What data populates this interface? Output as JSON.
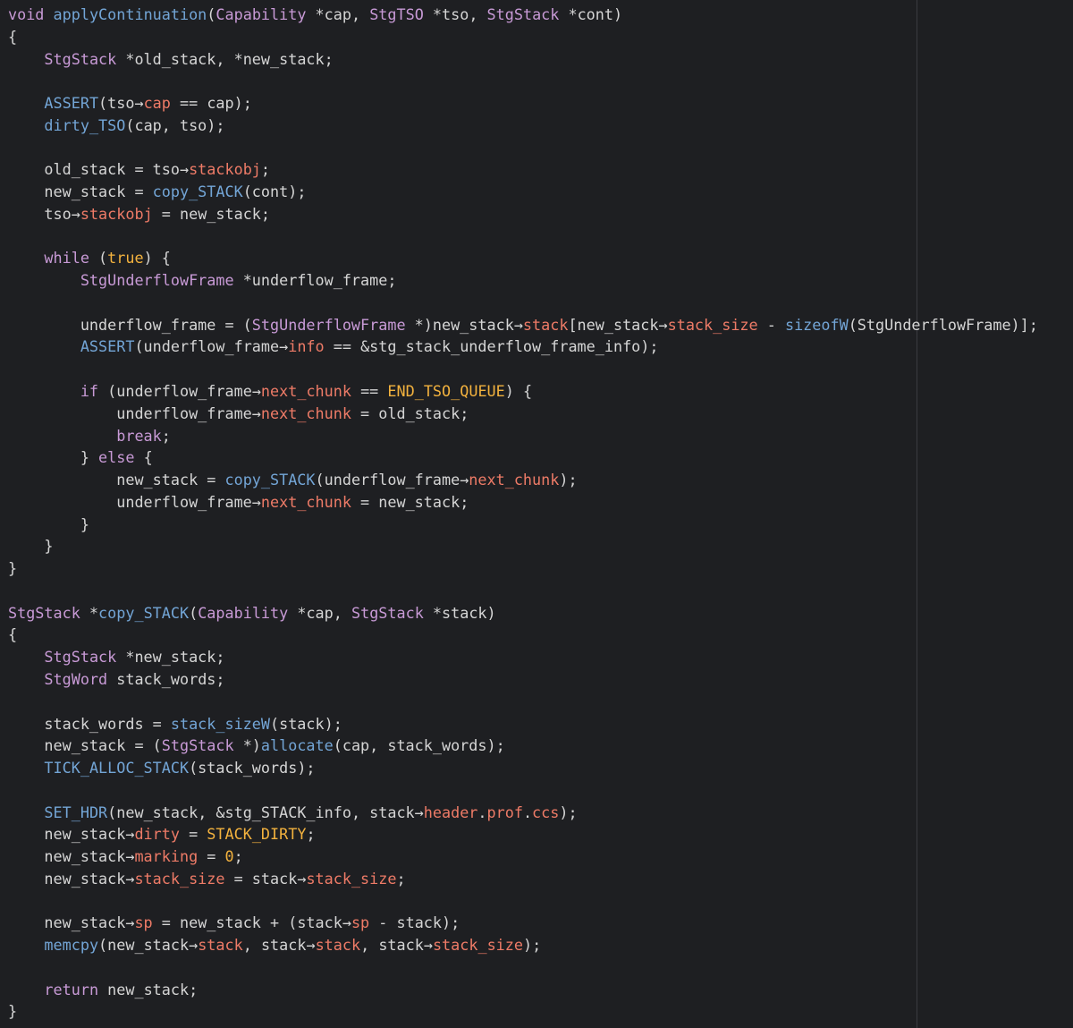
{
  "colors": {
    "background": "#1e1f22",
    "ruler": "#3a3b40",
    "keyword": "#c89ad6",
    "type": "#c89ad6",
    "function": "#73a5d6",
    "field": "#ee7b67",
    "constant": "#f3b23e",
    "number": "#f3b23e",
    "plain": "#d5d5d5"
  },
  "code_lines": [
    [
      [
        "kw",
        "void"
      ],
      [
        "pl",
        " "
      ],
      [
        "fn",
        "applyContinuation"
      ],
      [
        "pl",
        "("
      ],
      [
        "ty",
        "Capability"
      ],
      [
        "pl",
        " *cap, "
      ],
      [
        "ty",
        "StgTSO"
      ],
      [
        "pl",
        " *tso, "
      ],
      [
        "ty",
        "StgStack"
      ],
      [
        "pl",
        " *cont)"
      ]
    ],
    [
      [
        "pl",
        "{"
      ]
    ],
    [
      [
        "pl",
        "    "
      ],
      [
        "ty",
        "StgStack"
      ],
      [
        "pl",
        " *old_stack, *new_stack;"
      ]
    ],
    [],
    [
      [
        "pl",
        "    "
      ],
      [
        "fn",
        "ASSERT"
      ],
      [
        "pl",
        "(tso"
      ],
      [
        "op",
        "→"
      ],
      [
        "fld",
        "cap"
      ],
      [
        "pl",
        " "
      ],
      [
        "op",
        "=="
      ],
      [
        "pl",
        " cap);"
      ]
    ],
    [
      [
        "pl",
        "    "
      ],
      [
        "fn",
        "dirty_TSO"
      ],
      [
        "pl",
        "(cap, tso);"
      ]
    ],
    [],
    [
      [
        "pl",
        "    old_stack = tso"
      ],
      [
        "op",
        "→"
      ],
      [
        "fld",
        "stackobj"
      ],
      [
        "pl",
        ";"
      ]
    ],
    [
      [
        "pl",
        "    new_stack = "
      ],
      [
        "fn",
        "copy_STACK"
      ],
      [
        "pl",
        "(cont);"
      ]
    ],
    [
      [
        "pl",
        "    tso"
      ],
      [
        "op",
        "→"
      ],
      [
        "fld",
        "stackobj"
      ],
      [
        "pl",
        " = new_stack;"
      ]
    ],
    [],
    [
      [
        "pl",
        "    "
      ],
      [
        "kw",
        "while"
      ],
      [
        "pl",
        " ("
      ],
      [
        "cst",
        "true"
      ],
      [
        "pl",
        ") {"
      ]
    ],
    [
      [
        "pl",
        "        "
      ],
      [
        "ty",
        "StgUnderflowFrame"
      ],
      [
        "pl",
        " *underflow_frame;"
      ]
    ],
    [],
    [
      [
        "pl",
        "        underflow_frame = ("
      ],
      [
        "ty",
        "StgUnderflowFrame"
      ],
      [
        "pl",
        " *)new_stack"
      ],
      [
        "op",
        "→"
      ],
      [
        "fld",
        "stack"
      ],
      [
        "pl",
        "[new_stack"
      ],
      [
        "op",
        "→"
      ],
      [
        "fld",
        "stack_size"
      ],
      [
        "pl",
        " - "
      ],
      [
        "fn",
        "sizeofW"
      ],
      [
        "pl",
        "(StgUnderflowFrame)];"
      ]
    ],
    [
      [
        "pl",
        "        "
      ],
      [
        "fn",
        "ASSERT"
      ],
      [
        "pl",
        "(underflow_frame"
      ],
      [
        "op",
        "→"
      ],
      [
        "fld",
        "info"
      ],
      [
        "pl",
        " "
      ],
      [
        "op",
        "=="
      ],
      [
        "pl",
        " &stg_stack_underflow_frame_info);"
      ]
    ],
    [],
    [
      [
        "pl",
        "        "
      ],
      [
        "kw",
        "if"
      ],
      [
        "pl",
        " (underflow_frame"
      ],
      [
        "op",
        "→"
      ],
      [
        "fld",
        "next_chunk"
      ],
      [
        "pl",
        " "
      ],
      [
        "op",
        "=="
      ],
      [
        "pl",
        " "
      ],
      [
        "cst",
        "END_TSO_QUEUE"
      ],
      [
        "pl",
        ") {"
      ]
    ],
    [
      [
        "pl",
        "            underflow_frame"
      ],
      [
        "op",
        "→"
      ],
      [
        "fld",
        "next_chunk"
      ],
      [
        "pl",
        " = old_stack;"
      ]
    ],
    [
      [
        "pl",
        "            "
      ],
      [
        "kw",
        "break"
      ],
      [
        "pl",
        ";"
      ]
    ],
    [
      [
        "pl",
        "        } "
      ],
      [
        "kw",
        "else"
      ],
      [
        "pl",
        " {"
      ]
    ],
    [
      [
        "pl",
        "            new_stack = "
      ],
      [
        "fn",
        "copy_STACK"
      ],
      [
        "pl",
        "(underflow_frame"
      ],
      [
        "op",
        "→"
      ],
      [
        "fld",
        "next_chunk"
      ],
      [
        "pl",
        ");"
      ]
    ],
    [
      [
        "pl",
        "            underflow_frame"
      ],
      [
        "op",
        "→"
      ],
      [
        "fld",
        "next_chunk"
      ],
      [
        "pl",
        " = new_stack;"
      ]
    ],
    [
      [
        "pl",
        "        }"
      ]
    ],
    [
      [
        "pl",
        "    }"
      ]
    ],
    [
      [
        "pl",
        "}"
      ]
    ],
    [],
    [
      [
        "ty",
        "StgStack"
      ],
      [
        "pl",
        " *"
      ],
      [
        "fn",
        "copy_STACK"
      ],
      [
        "pl",
        "("
      ],
      [
        "ty",
        "Capability"
      ],
      [
        "pl",
        " *cap, "
      ],
      [
        "ty",
        "StgStack"
      ],
      [
        "pl",
        " *stack)"
      ]
    ],
    [
      [
        "pl",
        "{"
      ]
    ],
    [
      [
        "pl",
        "    "
      ],
      [
        "ty",
        "StgStack"
      ],
      [
        "pl",
        " *new_stack;"
      ]
    ],
    [
      [
        "pl",
        "    "
      ],
      [
        "ty",
        "StgWord"
      ],
      [
        "pl",
        " stack_words;"
      ]
    ],
    [],
    [
      [
        "pl",
        "    stack_words = "
      ],
      [
        "fn",
        "stack_sizeW"
      ],
      [
        "pl",
        "(stack);"
      ]
    ],
    [
      [
        "pl",
        "    new_stack = ("
      ],
      [
        "ty",
        "StgStack"
      ],
      [
        "pl",
        " *)"
      ],
      [
        "fn",
        "allocate"
      ],
      [
        "pl",
        "(cap, stack_words);"
      ]
    ],
    [
      [
        "pl",
        "    "
      ],
      [
        "fn",
        "TICK_ALLOC_STACK"
      ],
      [
        "pl",
        "(stack_words);"
      ]
    ],
    [],
    [
      [
        "pl",
        "    "
      ],
      [
        "fn",
        "SET_HDR"
      ],
      [
        "pl",
        "(new_stack, &stg_STACK_info, stack"
      ],
      [
        "op",
        "→"
      ],
      [
        "fld",
        "header"
      ],
      [
        "pl",
        "."
      ],
      [
        "fld",
        "prof"
      ],
      [
        "pl",
        "."
      ],
      [
        "fld",
        "ccs"
      ],
      [
        "pl",
        ");"
      ]
    ],
    [
      [
        "pl",
        "    new_stack"
      ],
      [
        "op",
        "→"
      ],
      [
        "fld",
        "dirty"
      ],
      [
        "pl",
        " = "
      ],
      [
        "cst",
        "STACK_DIRTY"
      ],
      [
        "pl",
        ";"
      ]
    ],
    [
      [
        "pl",
        "    new_stack"
      ],
      [
        "op",
        "→"
      ],
      [
        "fld",
        "marking"
      ],
      [
        "pl",
        " = "
      ],
      [
        "num",
        "0"
      ],
      [
        "pl",
        ";"
      ]
    ],
    [
      [
        "pl",
        "    new_stack"
      ],
      [
        "op",
        "→"
      ],
      [
        "fld",
        "stack_size"
      ],
      [
        "pl",
        " = stack"
      ],
      [
        "op",
        "→"
      ],
      [
        "fld",
        "stack_size"
      ],
      [
        "pl",
        ";"
      ]
    ],
    [],
    [
      [
        "pl",
        "    new_stack"
      ],
      [
        "op",
        "→"
      ],
      [
        "fld",
        "sp"
      ],
      [
        "pl",
        " = new_stack + (stack"
      ],
      [
        "op",
        "→"
      ],
      [
        "fld",
        "sp"
      ],
      [
        "pl",
        " - stack);"
      ]
    ],
    [
      [
        "pl",
        "    "
      ],
      [
        "fn",
        "memcpy"
      ],
      [
        "pl",
        "(new_stack"
      ],
      [
        "op",
        "→"
      ],
      [
        "fld",
        "stack"
      ],
      [
        "pl",
        ", stack"
      ],
      [
        "op",
        "→"
      ],
      [
        "fld",
        "stack"
      ],
      [
        "pl",
        ", stack"
      ],
      [
        "op",
        "→"
      ],
      [
        "fld",
        "stack_size"
      ],
      [
        "pl",
        ");"
      ]
    ],
    [],
    [
      [
        "pl",
        "    "
      ],
      [
        "kw",
        "return"
      ],
      [
        "pl",
        " new_stack;"
      ]
    ],
    [
      [
        "pl",
        "}"
      ]
    ]
  ]
}
